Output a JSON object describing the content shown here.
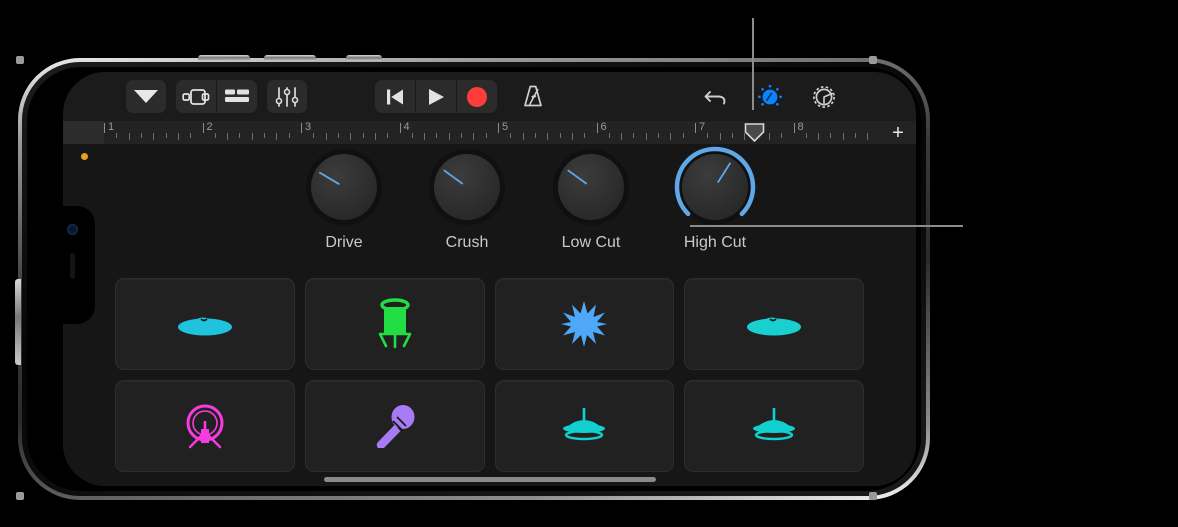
{
  "device": {
    "name": "iphone-landscape"
  },
  "app": {
    "name": "GarageBand"
  },
  "callouts": [
    {
      "name": "control-settings-callout",
      "target": "automation-knob-toolbar-icon"
    },
    {
      "name": "high-cut-knob-callout",
      "target": "high-cut-knob"
    }
  ],
  "toolbar": {
    "navigation_group": [
      {
        "name": "my-songs-button",
        "icon": "triangle-down-icon",
        "label": ""
      }
    ],
    "view_group": [
      {
        "name": "live-loops-view-button",
        "icon": "cells-view-icon",
        "label": ""
      },
      {
        "name": "tracks-view-button",
        "icon": "tracks-view-icon",
        "label": ""
      }
    ],
    "mixer_group": [
      {
        "name": "mixer-button",
        "icon": "faders-icon",
        "label": ""
      }
    ],
    "transport_group": [
      {
        "name": "rewind-button",
        "icon": "rewind-icon",
        "label": ""
      },
      {
        "name": "play-button",
        "icon": "play-icon",
        "label": ""
      },
      {
        "name": "record-button",
        "icon": "record-icon",
        "label": ""
      }
    ],
    "metronome": {
      "name": "metronome-button",
      "icon": "metronome-icon",
      "label": ""
    },
    "right_group": [
      {
        "name": "undo-button",
        "icon": "undo-arrow-icon",
        "label": ""
      },
      {
        "name": "automation-knob-toolbar-icon",
        "icon": "knob-icon",
        "label": "",
        "active": true
      },
      {
        "name": "settings-button",
        "icon": "gear-icon",
        "label": ""
      }
    ],
    "accent_color": "#0a84ff",
    "record_color": "#fc3d39"
  },
  "ruler": {
    "bars": [
      "1",
      "2",
      "3",
      "4",
      "5",
      "6",
      "7",
      "8"
    ],
    "beats_per_bar": 4,
    "playhead_bar": 7.6,
    "add_button": {
      "name": "add-section-button",
      "label": "+"
    }
  },
  "recording_indicator": {
    "name": "recording-indicator-dot",
    "color": "#e8a020"
  },
  "knobs": [
    {
      "name": "drive-knob",
      "label": "Drive",
      "value": 0.28,
      "active": false
    },
    {
      "name": "crush-knob",
      "label": "Crush",
      "value": 0.3,
      "active": false
    },
    {
      "name": "low-cut-knob",
      "label": "Low Cut",
      "value": 0.3,
      "active": false
    },
    {
      "name": "high-cut-knob",
      "label": "High Cut",
      "value": 0.62,
      "active": true
    }
  ],
  "pads": [
    {
      "name": "pad-crash-cymbal-1",
      "icon": "cymbal-icon",
      "color": "#1fc3dd"
    },
    {
      "name": "pad-tom-drum",
      "icon": "conga-drum-icon",
      "color": "#22dd44"
    },
    {
      "name": "pad-clap-burst",
      "icon": "starburst-icon",
      "color": "#4ea8f7"
    },
    {
      "name": "pad-crash-cymbal-2",
      "icon": "cymbal-icon",
      "color": "#19cfcf"
    },
    {
      "name": "pad-gong",
      "icon": "gong-icon",
      "color": "#f63ce0"
    },
    {
      "name": "pad-shaker",
      "icon": "maraca-icon",
      "color": "#a67bf5"
    },
    {
      "name": "pad-hihat-1",
      "icon": "hihat-icon",
      "color": "#12cfd0"
    },
    {
      "name": "pad-hihat-2",
      "icon": "hihat-icon",
      "color": "#12cfd0"
    }
  ]
}
